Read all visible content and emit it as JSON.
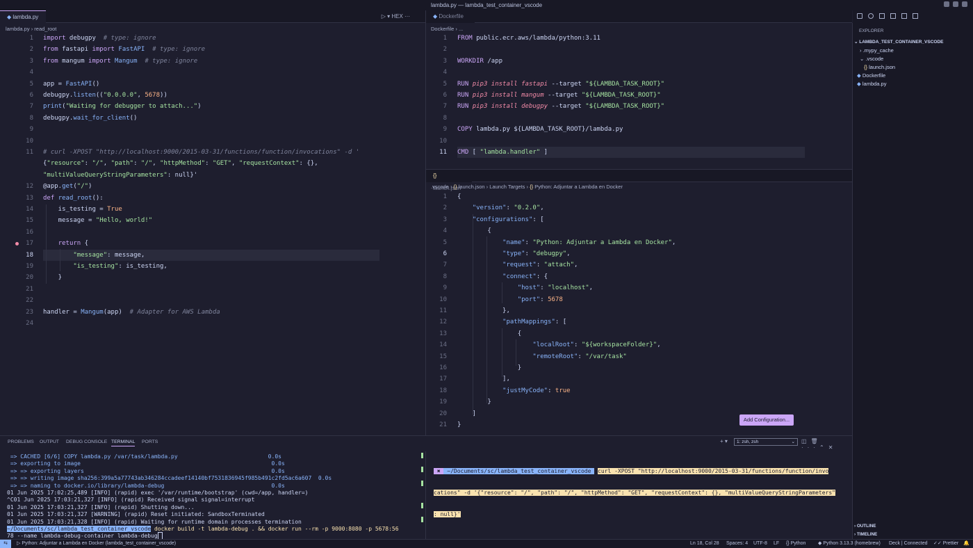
{
  "window": {
    "title": "lambda.py — lambda_test_container_vscode"
  },
  "left_editor": {
    "tab": "lambda.py",
    "run_label": "HEX",
    "breadcrumb": [
      "lambda.py",
      "read_root"
    ],
    "lines": [
      {
        "n": "1",
        "t": "import debugpy  # type: ignore"
      },
      {
        "n": "2",
        "t": "from fastapi import FastAPI  # type: ignore"
      },
      {
        "n": "3",
        "t": "from mangum import Mangum  # type: ignore"
      },
      {
        "n": "4",
        "t": ""
      },
      {
        "n": "5",
        "t": "app = FastAPI()"
      },
      {
        "n": "6",
        "t": "debugpy.listen((\"0.0.0.0\", 5678))"
      },
      {
        "n": "7",
        "t": "print(\"Waiting for debugger to attach...\")"
      },
      {
        "n": "8",
        "t": "debugpy.wait_for_client()"
      },
      {
        "n": "9",
        "t": ""
      },
      {
        "n": "10",
        "t": ""
      },
      {
        "n": "11",
        "t": "# curl -XPOST \"http://localhost:9000/2015-03-31/functions/function/invocations\" -d '"
      },
      {
        "n": "",
        "t": "{\"resource\": \"/\", \"path\": \"/\", \"httpMethod\": \"GET\", \"requestContext\": {},"
      },
      {
        "n": "",
        "t": "\"multiValueQueryStringParameters\": null}'"
      },
      {
        "n": "12",
        "t": "@app.get(\"/\")"
      },
      {
        "n": "13",
        "t": "def read_root():"
      },
      {
        "n": "14",
        "t": "    is_testing = True"
      },
      {
        "n": "15",
        "t": "    message = \"Hello, world!\""
      },
      {
        "n": "16",
        "t": ""
      },
      {
        "n": "17",
        "t": "    return {"
      },
      {
        "n": "18",
        "t": "        \"message\": message,"
      },
      {
        "n": "19",
        "t": "        \"is_testing\": is_testing,"
      },
      {
        "n": "20",
        "t": "    }"
      },
      {
        "n": "21",
        "t": ""
      },
      {
        "n": "22",
        "t": ""
      },
      {
        "n": "23",
        "t": "handler = Mangum(app)  # Adapter for AWS Lambda"
      },
      {
        "n": "24",
        "t": ""
      }
    ]
  },
  "docker_editor": {
    "tab": "Dockerfile",
    "breadcrumb": [
      "Dockerfile",
      "..."
    ],
    "lines": [
      {
        "n": "1",
        "t": "FROM public.ecr.aws/lambda/python:3.11"
      },
      {
        "n": "2",
        "t": ""
      },
      {
        "n": "3",
        "t": "WORKDIR /app"
      },
      {
        "n": "4",
        "t": ""
      },
      {
        "n": "5",
        "t": "RUN pip3 install fastapi --target \"${LAMBDA_TASK_ROOT}\""
      },
      {
        "n": "6",
        "t": "RUN pip3 install mangum --target \"${LAMBDA_TASK_ROOT}\""
      },
      {
        "n": "7",
        "t": "RUN pip3 install debugpy --target \"${LAMBDA_TASK_ROOT}\""
      },
      {
        "n": "8",
        "t": ""
      },
      {
        "n": "9",
        "t": "COPY lambda.py ${LAMBDA_TASK_ROOT}/lambda.py"
      },
      {
        "n": "10",
        "t": ""
      },
      {
        "n": "11",
        "t": "CMD [ \"lambda.handler\" ]"
      }
    ]
  },
  "launch_editor": {
    "tab": "launch.json",
    "breadcrumb": [
      ".vscode",
      "launch.json",
      "Launch Targets",
      "Python: Adjuntar a Lambda en Docker"
    ],
    "lines": [
      {
        "n": "1",
        "t": "{"
      },
      {
        "n": "2",
        "t": "    \"version\": \"0.2.0\","
      },
      {
        "n": "3",
        "t": "    \"configurations\": ["
      },
      {
        "n": "4",
        "t": "        {"
      },
      {
        "n": "5",
        "t": "            \"name\": \"Python: Adjuntar a Lambda en Docker\","
      },
      {
        "n": "6",
        "t": "            \"type\": \"debugpy\","
      },
      {
        "n": "7",
        "t": "            \"request\": \"attach\","
      },
      {
        "n": "8",
        "t": "            \"connect\": {"
      },
      {
        "n": "9",
        "t": "                \"host\": \"localhost\","
      },
      {
        "n": "10",
        "t": "                \"port\": 5678"
      },
      {
        "n": "11",
        "t": "            },"
      },
      {
        "n": "12",
        "t": "            \"pathMappings\": ["
      },
      {
        "n": "13",
        "t": "                {"
      },
      {
        "n": "14",
        "t": "                    \"localRoot\": \"${workspaceFolder}\","
      },
      {
        "n": "15",
        "t": "                    \"remoteRoot\": \"/var/task\""
      },
      {
        "n": "16",
        "t": "                }"
      },
      {
        "n": "17",
        "t": "            ],"
      },
      {
        "n": "18",
        "t": "            \"justMyCode\": true"
      },
      {
        "n": "19",
        "t": "        }"
      },
      {
        "n": "20",
        "t": "    ]"
      },
      {
        "n": "21",
        "t": "}"
      }
    ],
    "add_config": "Add Configuration..."
  },
  "explorer": {
    "title": "EXPLORER",
    "root": "LAMBDA_TEST_CONTAINER_VSCODE",
    "items": [
      ".mypy_cache",
      ".vscode",
      "launch.json",
      "Dockerfile",
      "lambda.py"
    ],
    "outline": "OUTLINE",
    "timeline": "TIMELINE"
  },
  "panel": {
    "tabs": [
      "PROBLEMS",
      "OUTPUT",
      "DEBUG CONSOLE",
      "TERMINAL",
      "PORTS"
    ],
    "shell_select": "1: zsh, zsh",
    "left_term": [
      " => CACHED [6/6] COPY lambda.py /var/task/lambda.py                           0.0s",
      " => exporting to image                                                         0.0s",
      " => => exporting layers                                                        0.0s",
      " => => writing image sha256:399a5a77743ab346284ccadeef14140bf7531836945f985b491c2fd5ac6a607  0.0s",
      " => => naming to docker.io/library/lambda-debug                                0.0s",
      "01 Jun 2025 17:02:25,489 [INFO] (rapid) exec '/var/runtime/bootstrap' (cwd=/app, handler=)",
      "^C01 Jun 2025 17:03:21,327 [INFO] (rapid) Received signal signal=interrupt",
      "01 Jun 2025 17:03:21,327 [INFO] (rapid) Shutting down...",
      "01 Jun 2025 17:03:21,327 [WARNING] (rapid) Reset initiated: SandboxTerminated",
      "01 Jun 2025 17:03:21,328 [INFO] (rapid) Waiting for runtime domain processes termination"
    ],
    "left_prompt": "~/Documents/sc/lambda_test_container_vscode",
    "left_cmd": "docker build -t lambda-debug . && docker run --rm -p 9000:8080 -p 5678:56",
    "left_cmd2": "78 --name lambda-debug-container lambda-debug",
    "right_prompt": "~/Documents/sc/lambda_test_container_vscode",
    "right_cmd1": "curl -XPOST \"http://localhost:9000/2015-03-31/functions/function/invo",
    "right_cmd2": "cations\" -d '{\"resource\": \"/\", \"path\": \"/\", \"httpMethod\": \"GET\", \"requestContext\": {}, \"multiValueQueryStringParameters\"",
    "right_cmd3": ": null}'"
  },
  "status": {
    "debug": "Python: Adjuntar a Lambda en Docker (lambda_test_container_vscode)",
    "position": "Ln 18, Col 28",
    "spaces": "Spaces: 4",
    "encoding": "UTF-8",
    "eol": "LF",
    "language": "Python",
    "interpreter": "Python 3.13.3 (homebrew)",
    "deck": "Deck | Connected",
    "prettier": "Prettier"
  }
}
